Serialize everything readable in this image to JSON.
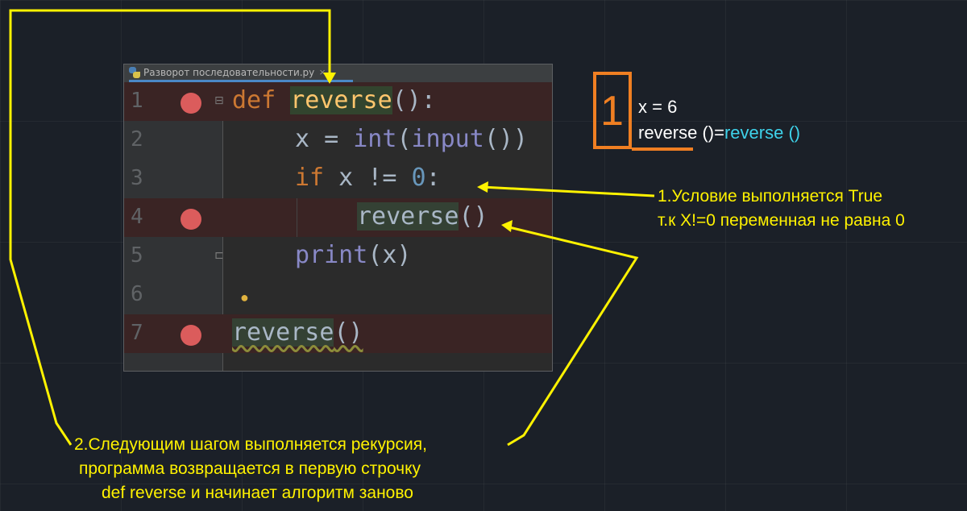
{
  "editor": {
    "tab_title": "Разворот последовательности.py",
    "tab_close": "×",
    "lines": [
      {
        "n": "1"
      },
      {
        "n": "2"
      },
      {
        "n": "3"
      },
      {
        "n": "4"
      },
      {
        "n": "5"
      },
      {
        "n": "6"
      },
      {
        "n": "7"
      }
    ],
    "code": {
      "l1_kw": "def",
      "l1_fn": "reverse",
      "l1_rest": "():",
      "l2_a": "x = ",
      "l2_int": "int",
      "l2_b": "(",
      "l2_input": "input",
      "l2_c": "())",
      "l3_kw": "if",
      "l3_a": " x != ",
      "l3_num": "0",
      "l3_b": ":",
      "l4_call": "reverse",
      "l4_rest": "()",
      "l5_print": "print",
      "l5_rest": "(x)",
      "l7_call": "reverse",
      "l7_rest": "()"
    }
  },
  "annotations": {
    "counter": "1",
    "vars_line1": "x = 6",
    "vars_line2_a": "reverse ()=",
    "vars_line2_b": "reverse ()",
    "note1_line1": "1.Условие выполняется True",
    "note1_line2": "т.к X!=0 переменная не равна 0",
    "note2_line1": "2.Следующим шагом выполняется рекурсия,",
    "note2_line2": "программа возвращается в первую строчку",
    "note2_line3": "def reverse и начинает алгоритм заново"
  },
  "colors": {
    "breakpoint": "#db5c5c",
    "annotation_yellow": "#fff200",
    "counter_orange": "#f07f22",
    "cyan": "#3ed2ea"
  }
}
